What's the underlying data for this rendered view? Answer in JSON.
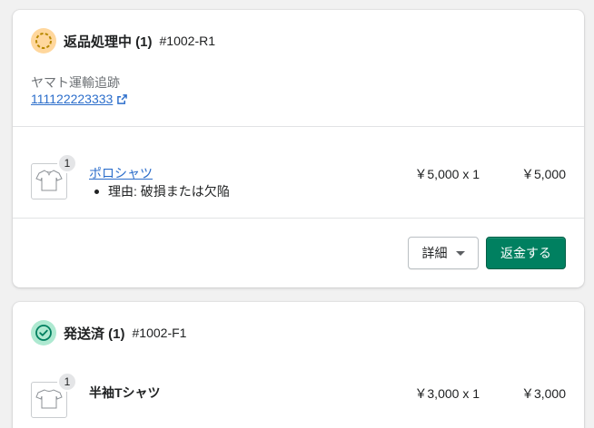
{
  "return_card": {
    "status_title": "返品処理中 (1)",
    "order_id": "#1002-R1",
    "tracking_label": "ヤマト運輸追跡",
    "tracking_number": "111122223333",
    "item": {
      "quantity": "1",
      "name": "ポロシャツ",
      "reason": "理由: 破損または欠陥",
      "unit_price": "￥5,000 x 1",
      "total": "￥5,000"
    },
    "details_label": "詳細",
    "refund_label": "返金する"
  },
  "fulfilled_card": {
    "status_title": "発送済 (1)",
    "order_id": "#1002-F1",
    "item": {
      "quantity": "1",
      "name": "半袖Tシャツ",
      "unit_price": "￥3,000 x 1",
      "total": "￥3,000"
    }
  },
  "colors": {
    "in_progress": "#ffd79d",
    "fulfilled": "#aee9d1",
    "primary": "#008060",
    "link": "#2c6ecb"
  },
  "icons": {
    "return_status": "in-progress-circle-icon",
    "fulfilled_status": "check-circle-icon",
    "external_link": "external-link-icon",
    "product_thumbnail": "shirt-icon"
  }
}
